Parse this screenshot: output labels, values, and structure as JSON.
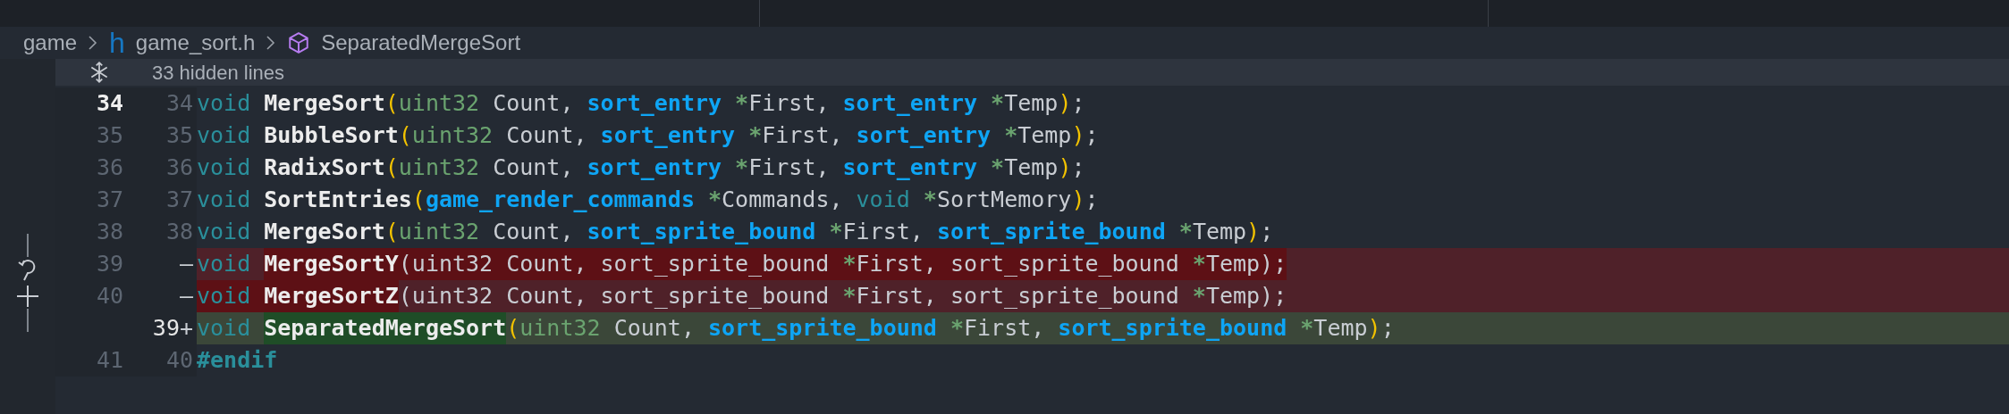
{
  "breadcrumb": {
    "items": [
      {
        "kind": "folder",
        "label": "game"
      },
      {
        "kind": "file",
        "icon": "h",
        "label": "game_sort.h"
      },
      {
        "kind": "symbol",
        "label": "SeparatedMergeSort"
      }
    ]
  },
  "hidden_lines": {
    "label": "33 hidden lines"
  },
  "lines": [
    {
      "kind": "context",
      "old": "34",
      "new": "34",
      "current": true,
      "segments": [
        {
          "changed": false,
          "tokens": [
            {
              "text": "void ",
              "kind": "keyword"
            },
            {
              "text": "MergeSort",
              "kind": "function"
            },
            {
              "text": "(",
              "kind": "paren"
            },
            {
              "text": "uint32",
              "kind": "builtin"
            },
            {
              "text": " Count, ",
              "kind": "plain"
            },
            {
              "text": "sort_entry ",
              "kind": "type"
            },
            {
              "text": "*",
              "kind": "star"
            },
            {
              "text": "First, ",
              "kind": "plain"
            },
            {
              "text": "sort_entry ",
              "kind": "type"
            },
            {
              "text": "*",
              "kind": "star"
            },
            {
              "text": "Temp",
              "kind": "plain"
            },
            {
              "text": ")",
              "kind": "paren"
            },
            {
              "text": ";",
              "kind": "plain"
            }
          ]
        }
      ]
    },
    {
      "kind": "context",
      "old": "35",
      "new": "35",
      "current": false,
      "segments": [
        {
          "changed": false,
          "tokens": [
            {
              "text": "void ",
              "kind": "keyword"
            },
            {
              "text": "BubbleSort",
              "kind": "function"
            },
            {
              "text": "(",
              "kind": "paren"
            },
            {
              "text": "uint32",
              "kind": "builtin"
            },
            {
              "text": " Count, ",
              "kind": "plain"
            },
            {
              "text": "sort_entry ",
              "kind": "type"
            },
            {
              "text": "*",
              "kind": "star"
            },
            {
              "text": "First, ",
              "kind": "plain"
            },
            {
              "text": "sort_entry ",
              "kind": "type"
            },
            {
              "text": "*",
              "kind": "star"
            },
            {
              "text": "Temp",
              "kind": "plain"
            },
            {
              "text": ")",
              "kind": "paren"
            },
            {
              "text": ";",
              "kind": "plain"
            }
          ]
        }
      ]
    },
    {
      "kind": "context",
      "old": "36",
      "new": "36",
      "current": false,
      "segments": [
        {
          "changed": false,
          "tokens": [
            {
              "text": "void ",
              "kind": "keyword"
            },
            {
              "text": "RadixSort",
              "kind": "function"
            },
            {
              "text": "(",
              "kind": "paren"
            },
            {
              "text": "uint32",
              "kind": "builtin"
            },
            {
              "text": " Count, ",
              "kind": "plain"
            },
            {
              "text": "sort_entry ",
              "kind": "type"
            },
            {
              "text": "*",
              "kind": "star"
            },
            {
              "text": "First, ",
              "kind": "plain"
            },
            {
              "text": "sort_entry ",
              "kind": "type"
            },
            {
              "text": "*",
              "kind": "star"
            },
            {
              "text": "Temp",
              "kind": "plain"
            },
            {
              "text": ")",
              "kind": "paren"
            },
            {
              "text": ";",
              "kind": "plain"
            }
          ]
        }
      ]
    },
    {
      "kind": "context",
      "old": "37",
      "new": "37",
      "current": false,
      "segments": [
        {
          "changed": false,
          "tokens": [
            {
              "text": "void ",
              "kind": "keyword"
            },
            {
              "text": "SortEntries",
              "kind": "function"
            },
            {
              "text": "(",
              "kind": "paren"
            },
            {
              "text": "game_render_commands ",
              "kind": "type"
            },
            {
              "text": "*",
              "kind": "star"
            },
            {
              "text": "Commands, ",
              "kind": "plain"
            },
            {
              "text": "void ",
              "kind": "keyword"
            },
            {
              "text": "*",
              "kind": "star"
            },
            {
              "text": "SortMemory",
              "kind": "plain"
            },
            {
              "text": ")",
              "kind": "paren"
            },
            {
              "text": ";",
              "kind": "plain"
            }
          ]
        }
      ]
    },
    {
      "kind": "context",
      "old": "38",
      "new": "38",
      "current": false,
      "segments": [
        {
          "changed": false,
          "tokens": [
            {
              "text": "void ",
              "kind": "keyword"
            },
            {
              "text": "MergeSort",
              "kind": "function"
            },
            {
              "text": "(",
              "kind": "paren"
            },
            {
              "text": "uint32",
              "kind": "builtin"
            },
            {
              "text": " Count, ",
              "kind": "plain"
            },
            {
              "text": "sort_sprite_bound ",
              "kind": "type"
            },
            {
              "text": "*",
              "kind": "star"
            },
            {
              "text": "First, ",
              "kind": "plain"
            },
            {
              "text": "sort_sprite_bound ",
              "kind": "type"
            },
            {
              "text": "*",
              "kind": "star"
            },
            {
              "text": "Temp",
              "kind": "plain"
            },
            {
              "text": ")",
              "kind": "paren"
            },
            {
              "text": ";",
              "kind": "plain"
            }
          ]
        }
      ]
    },
    {
      "kind": "deleted",
      "old": "39",
      "marker": "—",
      "current": false,
      "segments": [
        {
          "changed": false,
          "tokens": [
            {
              "text": "void ",
              "kind": "keyword"
            }
          ]
        },
        {
          "changed": true,
          "tokens": [
            {
              "text": "MergeSortY",
              "kind": "function"
            },
            {
              "text": "(uint32 Count, sort_sprite_bound ",
              "kind": "plain"
            },
            {
              "text": "*",
              "kind": "star"
            },
            {
              "text": "First, sort_sprite_bound ",
              "kind": "plain"
            },
            {
              "text": "*",
              "kind": "star"
            },
            {
              "text": "Temp);",
              "kind": "plain"
            }
          ]
        }
      ]
    },
    {
      "kind": "deleted",
      "old": "40",
      "marker": "—",
      "current": false,
      "segments": [
        {
          "changed": true,
          "tokens": [
            {
              "text": "void ",
              "kind": "keyword"
            },
            {
              "text": "MergeSortZ",
              "kind": "function"
            }
          ]
        },
        {
          "changed": false,
          "tokens": [
            {
              "text": "(uint32 Count, sort_sprite_bound ",
              "kind": "plain"
            },
            {
              "text": "*",
              "kind": "star"
            },
            {
              "text": "First, sort_sprite_bound ",
              "kind": "plain"
            },
            {
              "text": "*",
              "kind": "star"
            },
            {
              "text": "Temp);",
              "kind": "plain"
            }
          ]
        }
      ]
    },
    {
      "kind": "added",
      "new": "39",
      "marker": "+",
      "segments": [
        {
          "changed": false,
          "tokens": [
            {
              "text": "void ",
              "kind": "keyword"
            }
          ]
        },
        {
          "changed": true,
          "tokens": [
            {
              "text": "SeparatedMergeSort",
              "kind": "function"
            }
          ]
        },
        {
          "changed": false,
          "tokens": [
            {
              "text": "(",
              "kind": "paren"
            },
            {
              "text": "uint32",
              "kind": "builtin"
            },
            {
              "text": " Count, ",
              "kind": "plain"
            },
            {
              "text": "sort_sprite_bound ",
              "kind": "type"
            },
            {
              "text": "*",
              "kind": "star"
            },
            {
              "text": "First, ",
              "kind": "plain"
            },
            {
              "text": "sort_sprite_bound ",
              "kind": "type"
            },
            {
              "text": "*",
              "kind": "star"
            },
            {
              "text": "Temp",
              "kind": "plain"
            },
            {
              "text": ")",
              "kind": "paren"
            },
            {
              "text": ";",
              "kind": "plain"
            }
          ]
        }
      ]
    },
    {
      "kind": "context",
      "old": "41",
      "new": "40",
      "current": false,
      "segments": [
        {
          "changed": false,
          "tokens": [
            {
              "text": "#endif",
              "kind": "directive"
            }
          ]
        }
      ]
    }
  ]
}
